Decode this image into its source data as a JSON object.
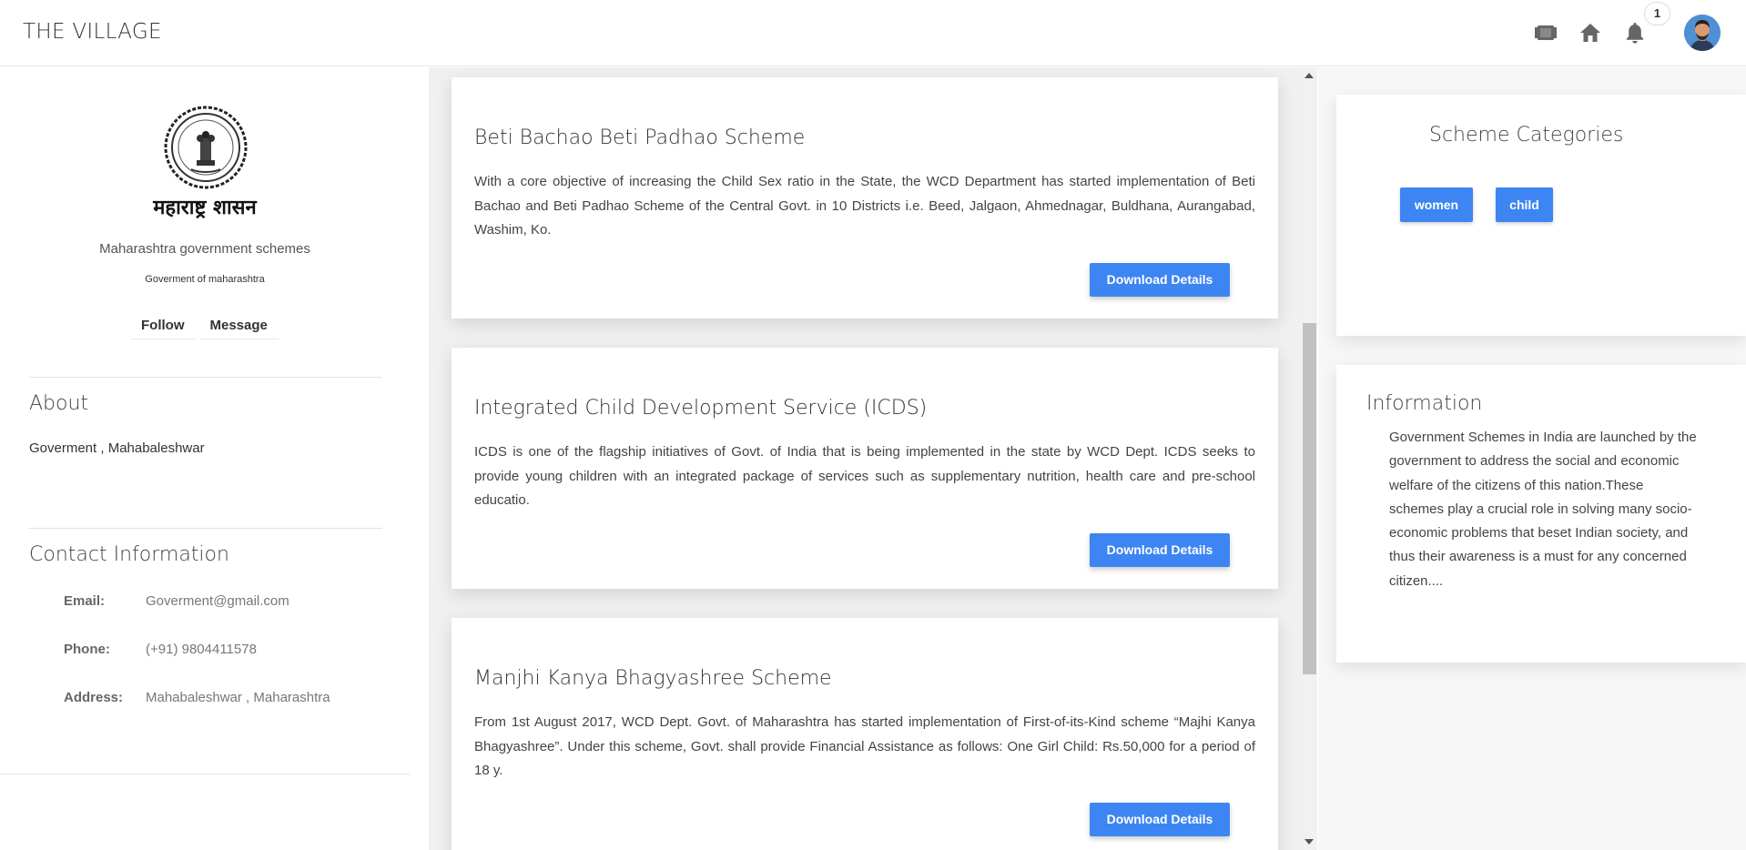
{
  "header": {
    "brand": "THE VILLAGE",
    "icons": [
      "film-icon",
      "home-icon",
      "bell-icon"
    ],
    "notification_count": "1"
  },
  "profile": {
    "emblem_caption": "महाराष्ट्र शासन",
    "title": "Maharashtra government schemes",
    "subtitle": "Goverment of maharashtra",
    "follow_label": "Follow",
    "message_label": "Message",
    "about_heading": "About",
    "about_text": "Goverment , Mahabaleshwar",
    "contact_heading": "Contact Information",
    "contact": [
      {
        "label": "Email:",
        "value": "Goverment@gmail.com"
      },
      {
        "label": "Phone:",
        "value": "(+91) 9804411578"
      },
      {
        "label": "Address:",
        "value": "Mahabaleshwar , Maharashtra"
      }
    ]
  },
  "schemes": [
    {
      "title": "Beti Bachao Beti Padhao Scheme",
      "description": "With a core objective of increasing the Child Sex ratio in the State, the WCD Department has started implementation of Beti Bachao and Beti Padhao Scheme of the Central Govt. in 10 Districts i.e. Beed, Jalgaon, Ahmednagar, Buldhana, Aurangabad, Washim, Ko.",
      "button": "Download Details"
    },
    {
      "title": "Integrated Child Development Service (ICDS)",
      "description": "ICDS is one of the flagship initiatives of Govt. of India that is being implemented in the state by WCD Dept. ICDS seeks to provide young children with an integrated package of services such as supplementary nutrition, health care and pre-school educatio.",
      "button": "Download Details"
    },
    {
      "title": "Manjhi Kanya Bhagyashree Scheme",
      "description": "From 1st August 2017, WCD Dept. Govt. of Maharashtra has started implementation of First-of-its-Kind scheme “Majhi Kanya Bhagyashree”. Under this scheme, Govt. shall provide Financial Assistance as follows: One Girl Child: Rs.50,000 for a period of 18 y.",
      "button": "Download Details"
    }
  ],
  "categories": {
    "heading": "Scheme Categories",
    "tags": [
      "women",
      "child"
    ]
  },
  "information": {
    "heading": "Information",
    "text": "Government Schemes in India are launched by the government to address the social and economic welfare of the citizens of this nation.These schemes play a crucial role in solving many socio-economic problems that beset Indian society, and thus their awareness is a must for any concerned citizen...."
  },
  "colors": {
    "accent": "#3d85f3",
    "icon": "#666666"
  }
}
